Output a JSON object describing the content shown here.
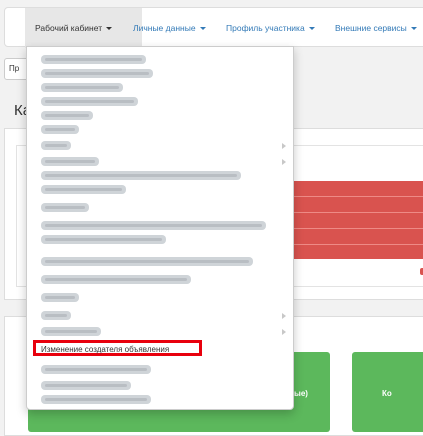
{
  "navbar": {
    "items": [
      {
        "label": "Рабочий кабинет",
        "active": true
      },
      {
        "label": "Личные данные",
        "active": false
      },
      {
        "label": "Профиль участника",
        "active": false
      },
      {
        "label": "Внешние сервисы",
        "active": false
      }
    ]
  },
  "background": {
    "button_label": "Пр",
    "heading": "Ка",
    "tile_text_1": "ые)",
    "tile_text_2": "Ко"
  },
  "dropdown": {
    "highlighted_item": "Изменение создателя объявления"
  },
  "colors": {
    "link": "#337ab7",
    "danger": "#d9534f",
    "success": "#5cb85c",
    "highlight_border": "#e8000d"
  }
}
